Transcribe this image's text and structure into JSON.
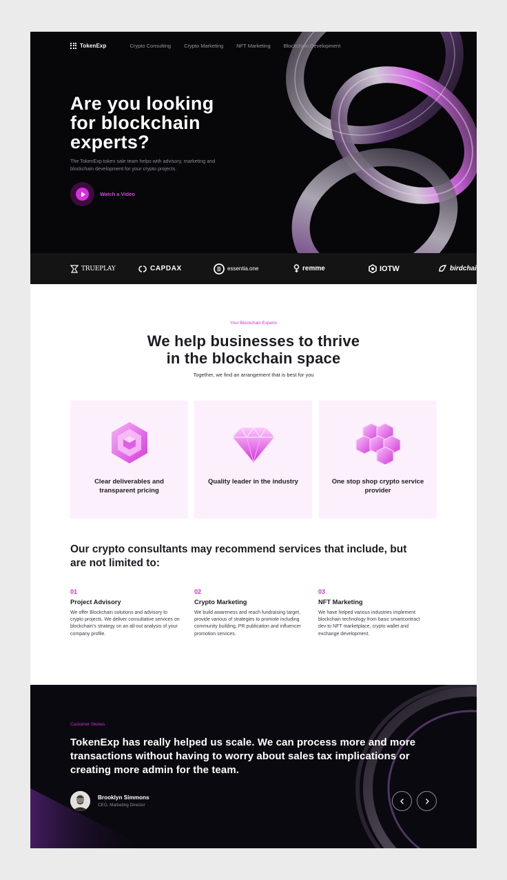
{
  "header": {
    "logo": "TokenExp",
    "nav": [
      "Crypto Consulting",
      "Crypto Marketing",
      "NFT Marketing",
      "Blockchain Development"
    ]
  },
  "hero": {
    "title_lines": [
      "Are you looking",
      "for blockchain",
      "experts?"
    ],
    "subtitle": "The TokenExp token sale team helps with advisory, marketing and blockchain development for your crypto projects.",
    "cta": "Watch a Video"
  },
  "partners": [
    "TRUEPLAY",
    "CAPDAX",
    "essentia.one",
    "remme",
    "IOTW",
    "birdchain"
  ],
  "intro": {
    "eyebrow": "Your Blockchain Experts",
    "title_lines": [
      "We help businesses to thrive",
      "in the blockchain space"
    ],
    "subtitle": "Together, we find an arrangement that is best for you"
  },
  "features": [
    {
      "title": "Clear deliverables and transparent pricing",
      "icon": "hexagon-cube-icon"
    },
    {
      "title": "Quality leader in the industry",
      "icon": "diamond-icon"
    },
    {
      "title": "One stop shop crypto service provider",
      "icon": "cubes-icon"
    }
  ],
  "services": {
    "heading": "Our crypto consultants may recommend services that include, but are not limited to:",
    "items": [
      {
        "num": "01",
        "title": "Project Advisory",
        "desc": "We offer Blockchain solutions and advisory to crypto projects. We deliver consultative services on blockchain's strategy on an all-out analysis of your company profile."
      },
      {
        "num": "02",
        "title": "Crypto Marketing",
        "desc": "We build awareness and reach fundraising target, provide various of strategies to promote including community building, PR publication and influencer promotion services."
      },
      {
        "num": "03",
        "title": "NFT Marketing",
        "desc": "We have helped various industries implement blockchain technology from basic smartcontract dev to NFT marketplace, crypto wallet and exchange development."
      }
    ]
  },
  "testimonial": {
    "eyebrow": "Customer Stories",
    "quote": "TokenExp has really helped us scale. We can process more and more transactions without having to worry about sales tax implications or creating more admin for the team.",
    "author": "Brooklyn Simmons",
    "role": "CEO, Marketing Director"
  },
  "colors": {
    "accent": "#d12fd6",
    "dark": "#070608",
    "card_bg": "#fdf0fd"
  }
}
